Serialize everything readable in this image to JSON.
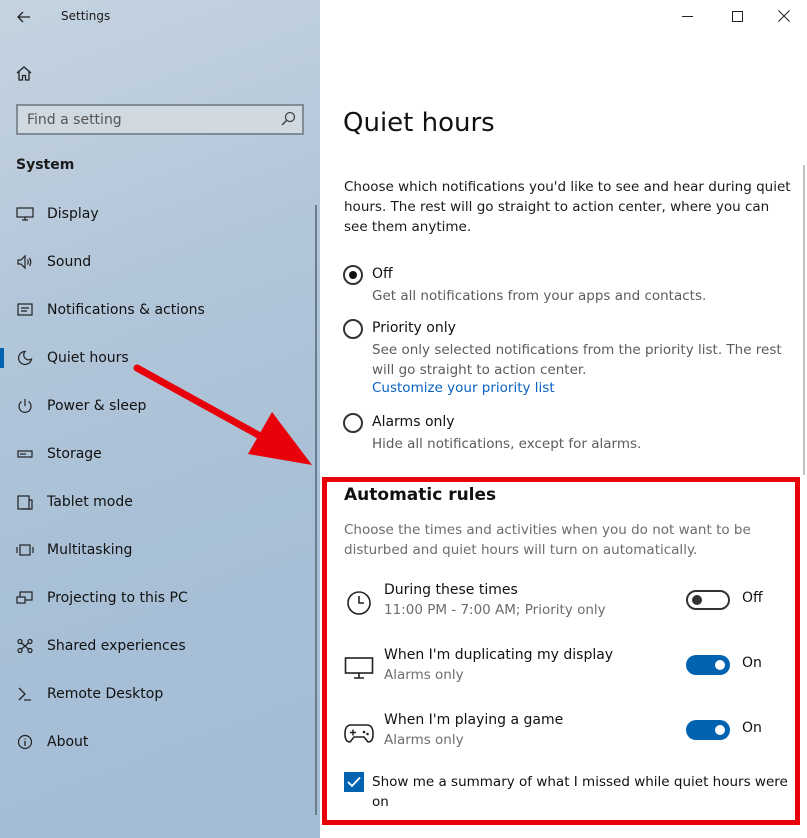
{
  "window": {
    "title": "Settings",
    "controls": {
      "minimize": "—",
      "maximize": "☐",
      "close": "✕"
    }
  },
  "sidebar": {
    "search_placeholder": "Find a setting",
    "section": "System",
    "items": [
      {
        "label": "Display",
        "icon": "display-icon"
      },
      {
        "label": "Sound",
        "icon": "speaker-icon"
      },
      {
        "label": "Notifications & actions",
        "icon": "notifications-icon"
      },
      {
        "label": "Quiet hours",
        "icon": "moon-icon",
        "active": true
      },
      {
        "label": "Power & sleep",
        "icon": "power-icon"
      },
      {
        "label": "Storage",
        "icon": "storage-icon"
      },
      {
        "label": "Tablet mode",
        "icon": "tablet-icon"
      },
      {
        "label": "Multitasking",
        "icon": "multitasking-icon"
      },
      {
        "label": "Projecting to this PC",
        "icon": "projecting-icon"
      },
      {
        "label": "Shared experiences",
        "icon": "shared-icon"
      },
      {
        "label": "Remote Desktop",
        "icon": "remote-desktop-icon"
      },
      {
        "label": "About",
        "icon": "info-icon"
      }
    ]
  },
  "main": {
    "title": "Quiet hours",
    "intro": "Choose which notifications you'd like to see and hear during quiet hours. The rest will go straight to action center, where you can see them anytime.",
    "options": [
      {
        "label": "Off",
        "desc": "Get all notifications from your apps and contacts.",
        "selected": true
      },
      {
        "label": "Priority only",
        "desc": "See only selected notifications from the priority list. The rest will go straight to action center.",
        "selected": false
      },
      {
        "label": "Alarms only",
        "desc": "Hide all notifications, except for alarms.",
        "selected": false
      }
    ],
    "priority_link": "Customize your priority list",
    "rules": {
      "title": "Automatic rules",
      "desc": "Choose the times and activities when you do not want to be disturbed and quiet hours will turn on automatically.",
      "items": [
        {
          "title": "During these times",
          "sub": "11:00 PM - 7:00 AM; Priority only",
          "state": "Off",
          "on": false,
          "icon": "clock-icon"
        },
        {
          "title": "When I'm duplicating my display",
          "sub": "Alarms only",
          "state": "On",
          "on": true,
          "icon": "monitor-icon"
        },
        {
          "title": "When I'm playing a game",
          "sub": "Alarms only",
          "state": "On",
          "on": true,
          "icon": "gamepad-icon"
        }
      ],
      "summary_checkbox": "Show me a summary of what I missed while quiet hours were on",
      "summary_checked": true
    }
  },
  "colors": {
    "accent": "#0063b1",
    "annotation": "#e8000b",
    "link": "#0a62c4"
  }
}
